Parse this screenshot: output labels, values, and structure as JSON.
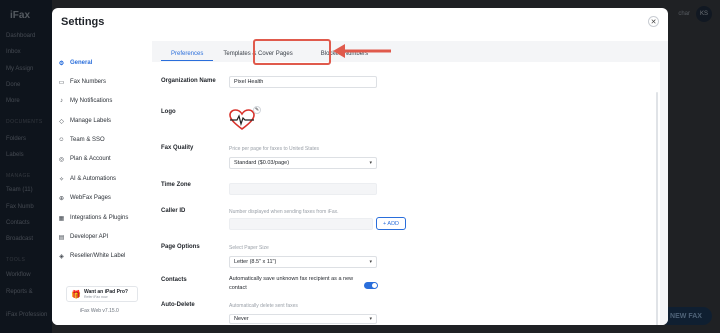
{
  "background": {
    "brand": "iFax",
    "sidebar_items": [
      "Dashboard",
      "Inbox",
      "My Assign",
      "Done",
      "More"
    ],
    "section_docs": "DOCUMENTS",
    "docs_items": [
      "Folders",
      "Labels"
    ],
    "section_manage": "MANAGE",
    "manage_items": [
      "Team (11)",
      "Fax Numb",
      "Contacts",
      "Broadcast"
    ],
    "section_tools": "TOOLS",
    "tools_items": [
      "Workflow",
      "Reports &"
    ],
    "footer": "iFax Profession",
    "user_name": "char",
    "avatar_initials": "KS",
    "new_fax_label": "NEW FAX"
  },
  "modal": {
    "title": "Settings",
    "close_icon": "close-icon",
    "nav": [
      {
        "label": "General",
        "icon": "gear-icon"
      },
      {
        "label": "Fax Numbers",
        "icon": "fax-icon"
      },
      {
        "label": "My Notifications",
        "icon": "bell-icon"
      },
      {
        "label": "Manage Labels",
        "icon": "tag-icon"
      },
      {
        "label": "Team & SSO",
        "icon": "team-icon"
      },
      {
        "label": "Plan & Account",
        "icon": "plan-icon"
      },
      {
        "label": "AI & Automations",
        "icon": "ai-icon"
      },
      {
        "label": "WebFax Pages",
        "icon": "globe-icon"
      },
      {
        "label": "Integrations & Plugins",
        "icon": "plugin-icon"
      },
      {
        "label": "Developer API",
        "icon": "code-icon"
      },
      {
        "label": "Reseller/White Label",
        "icon": "tag-icon"
      }
    ],
    "promo": {
      "title": "Want an iPad Pro?",
      "subtitle": "Refer iFax now"
    },
    "version": "iFax Web v7.15.0",
    "tabs": [
      "Preferences",
      "Templates & Cover Pages",
      "Blocked Numbers"
    ],
    "active_tab": "Preferences",
    "form": {
      "org_name_label": "Organization Name",
      "org_name_value": "Pixel Health",
      "logo_label": "Logo",
      "fax_quality_label": "Fax Quality",
      "fax_quality_hint": "Price per page for faxes to United States",
      "fax_quality_value": "Standard ($0.03/page)",
      "time_zone_label": "Time Zone",
      "caller_id_label": "Caller ID",
      "caller_id_hint": "Number displayed when sending faxes from iFax.",
      "add_button": "+ ADD",
      "page_options_label": "Page Options",
      "page_options_hint": "Select Paper Size",
      "page_options_value": "Letter (8.5\" x 11\")",
      "contacts_label": "Contacts",
      "contacts_text": "Automatically save unknown fax recipient as a new contact",
      "contacts_toggle": true,
      "auto_delete_label": "Auto-Delete",
      "auto_delete_hint": "Automatically delete sent faxes",
      "auto_delete_value": "Never"
    },
    "colors": {
      "accent": "#2a6edb",
      "callout": "#e05a4c"
    }
  }
}
